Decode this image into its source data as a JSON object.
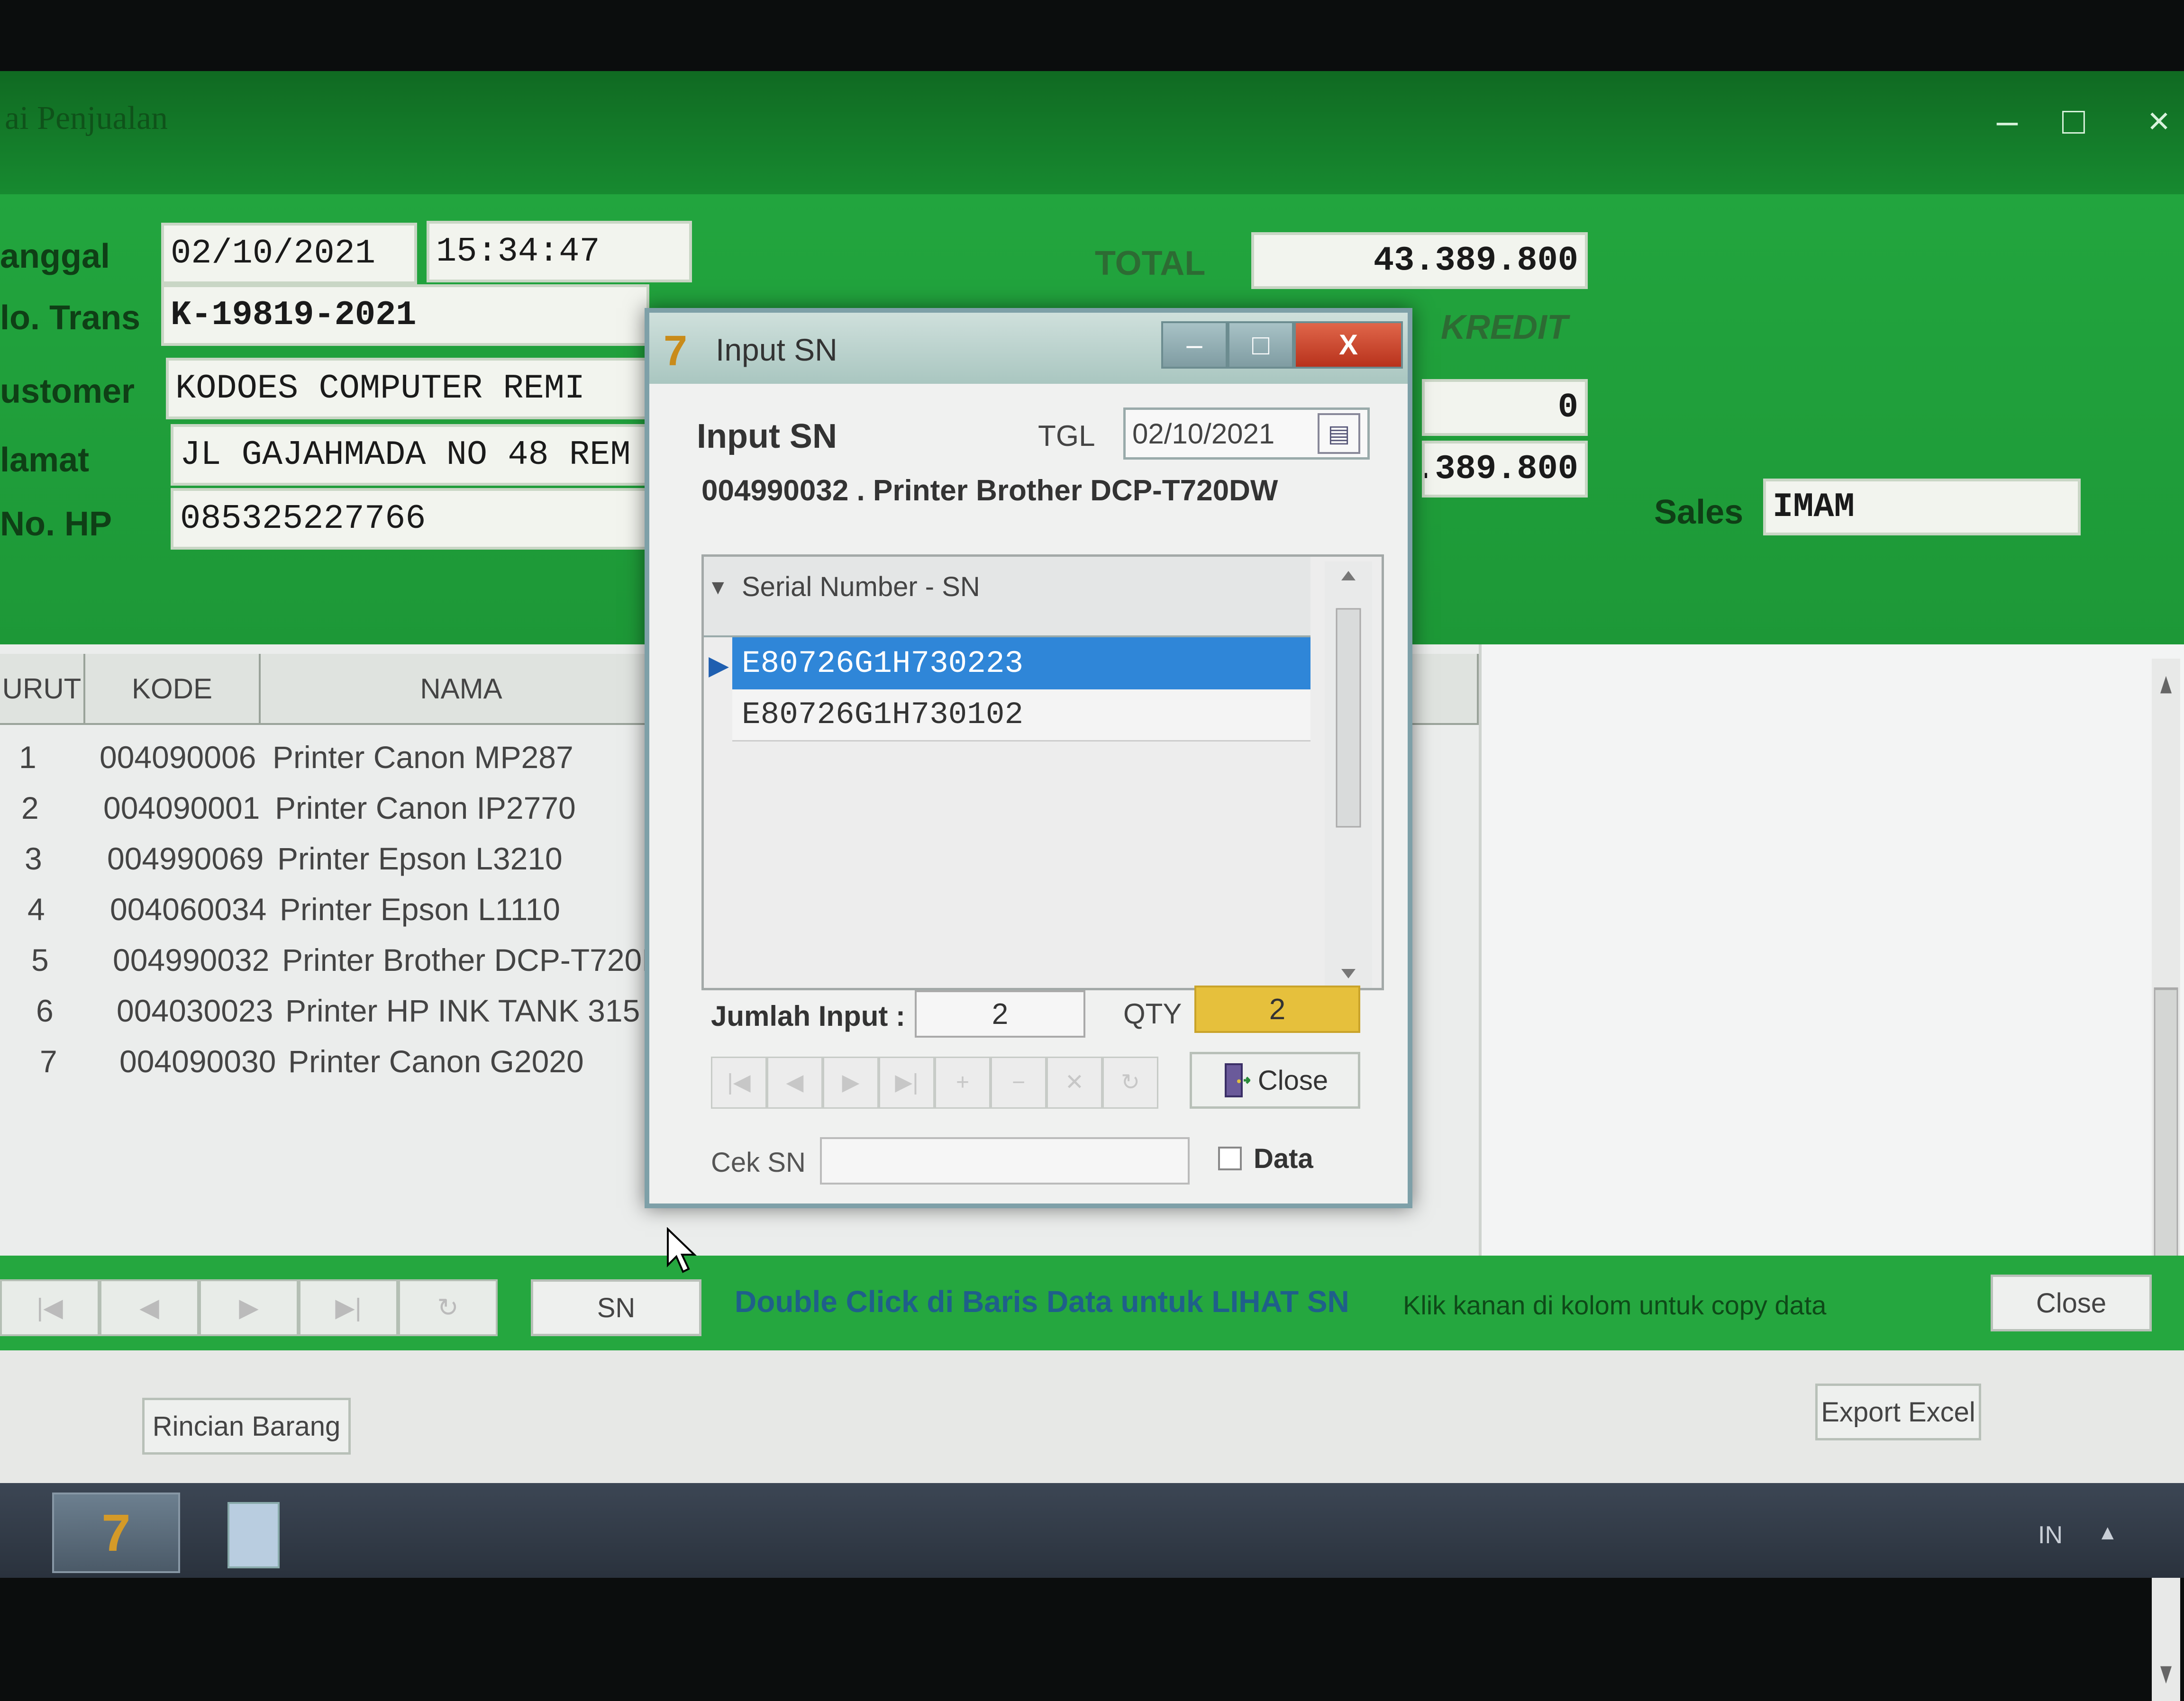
{
  "window": {
    "title": "ai Penjualan",
    "controls": {
      "minimize": "–",
      "maximize": "□",
      "close": "×"
    }
  },
  "header": {
    "tanggal_label": "anggal",
    "tanggal_date": "02/10/2021",
    "tanggal_time": "15:34:47",
    "notrans_label": "lo. Trans",
    "notrans_value": "K-19819-2021",
    "customer_label": "ustomer",
    "customer_value": "KODOES COMPUTER REMI",
    "alamat_label": "lamat",
    "alamat_value": "JL GAJAHMADA NO 48 REM",
    "nohp_label": "No. HP",
    "nohp_value": "085325227766",
    "total_label": "TOTAL",
    "total_value": "43.389.800",
    "kredit_label": "KREDIT",
    "field2_value": "0",
    "field3_value": "3.389.800",
    "sales_label": "Sales",
    "sales_value": "IMAM"
  },
  "grid": {
    "columns": [
      "URUT",
      "KODE",
      "NAMA"
    ],
    "rows": [
      {
        "no": "1",
        "kode": "004090006",
        "nama": "Printer Canon MP287"
      },
      {
        "no": "2",
        "kode": "004090001",
        "nama": "Printer Canon IP2770"
      },
      {
        "no": "3",
        "kode": "004990069",
        "nama": "Printer Epson L3210"
      },
      {
        "no": "4",
        "kode": "004060034",
        "nama": "Printer Epson L1110"
      },
      {
        "no": "5",
        "kode": "004990032",
        "nama": "Printer Brother DCP-T720D"
      },
      {
        "no": "6",
        "kode": "004030023",
        "nama": "Printer HP INK TANK 315"
      },
      {
        "no": "7",
        "kode": "004090030",
        "nama": "Printer Canon G2020"
      }
    ]
  },
  "bottom": {
    "sn_button": "SN",
    "hint_double_click": "Double Click di Baris Data untuk LIHAT SN",
    "hint_right_click": "Klik kanan di kolom untuk copy data",
    "close_button": "Close",
    "export_button": "Export Excel",
    "rincian_button": "Rincian Barang"
  },
  "dialog": {
    "title": "Input SN",
    "heading": "Input SN",
    "tgl_label": "TGL",
    "tgl_value": "02/10/2021",
    "product": "004990032 . Printer Brother DCP-T720DW",
    "sn_column": "Serial Number - SN",
    "serials": [
      "E80726G1H730223",
      "E80726G1H730102"
    ],
    "jumlah_label": "Jumlah Input :",
    "jumlah_value": "2",
    "qty_label": "QTY",
    "qty_value": "2",
    "close_button": "Close",
    "cek_sn_label": "Cek SN",
    "data_checkbox_label": "Data"
  },
  "taskbar": {
    "lang": "IN"
  },
  "colors": {
    "window_green": "#1f9b3a",
    "selection_blue": "#2f86d8",
    "qty_yellow": "#e6c03c",
    "close_red": "#c8402a"
  }
}
